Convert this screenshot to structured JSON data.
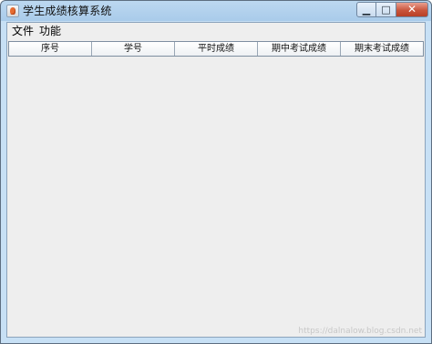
{
  "window": {
    "title": "学生成绩核算系统",
    "controls": {
      "minimize": "▁",
      "maximize": "□",
      "close": "✕"
    }
  },
  "menu": {
    "items": [
      "文件",
      "功能"
    ]
  },
  "table": {
    "columns": [
      "序号",
      "学号",
      "平时成绩",
      "期中考试成绩",
      "期末考试成绩"
    ],
    "rows": []
  },
  "watermark": "https://dalnalow.blog.csdn.net"
}
